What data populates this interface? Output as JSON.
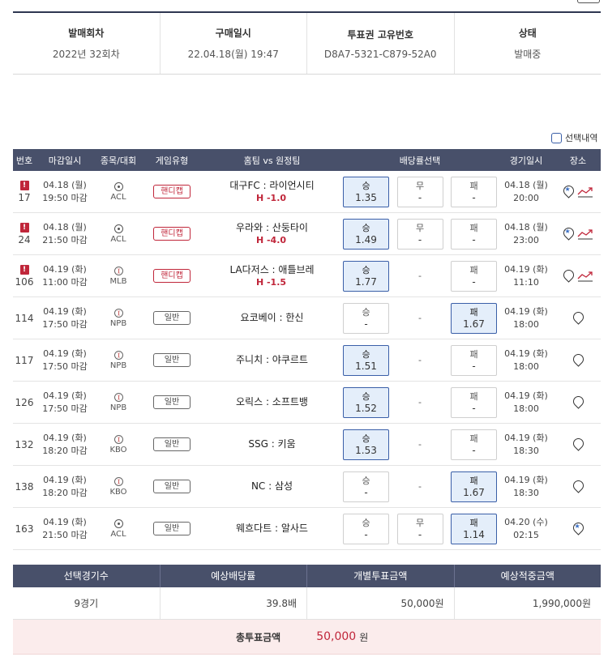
{
  "summary": [
    {
      "head": "발매회차",
      "value": "2022년 32회차"
    },
    {
      "head": "구매일시",
      "value": "22.04.18(월) 19:47"
    },
    {
      "head": "투표권 고유번호",
      "value": "D8A7-5321-C879-52A0"
    },
    {
      "head": "상태",
      "value": "발매중"
    }
  ],
  "selected_toggle": "선택내역",
  "headers": [
    "번호",
    "마감일시",
    "종목/대회",
    "게임유형",
    "홈팀 vs 원정팀",
    "배당률선택",
    "경기일시",
    "장소"
  ],
  "warn_mark": "!",
  "rows": [
    {
      "no": "17",
      "warn": true,
      "dd": "04.18 (월)",
      "dt": "19:50 마감",
      "sport": "soccer",
      "league": "ACL",
      "type": "핸디캡",
      "hc": true,
      "match": "대구FC : 라이언시티",
      "hcp": "H -1.0",
      "odds": [
        {
          "l": "승",
          "v": "1.35",
          "s": true
        },
        {
          "l": "무",
          "v": "-",
          "s": false
        },
        {
          "l": "패",
          "v": "-",
          "s": false
        }
      ],
      "gd": "04.18 (월)",
      "gt": "20:00",
      "place": "star-trend"
    },
    {
      "no": "24",
      "warn": true,
      "dd": "04.18 (월)",
      "dt": "21:50 마감",
      "sport": "soccer",
      "league": "ACL",
      "type": "핸디캡",
      "hc": true,
      "match": "우라와 : 산둥타이",
      "hcp": "H -4.0",
      "odds": [
        {
          "l": "승",
          "v": "1.49",
          "s": true
        },
        {
          "l": "무",
          "v": "-",
          "s": false
        },
        {
          "l": "패",
          "v": "-",
          "s": false
        }
      ],
      "gd": "04.18 (월)",
      "gt": "23:00",
      "place": "star-trend"
    },
    {
      "no": "106",
      "warn": true,
      "dd": "04.19 (화)",
      "dt": "11:00 마감",
      "sport": "baseball",
      "league": "MLB",
      "type": "핸디캡",
      "hc": true,
      "match": "LA다저스 : 애틀브레",
      "hcp": "H -1.5",
      "odds": [
        {
          "l": "승",
          "v": "1.77",
          "s": true
        },
        {
          "l": "-",
          "v": "",
          "s": false,
          "empty": true
        },
        {
          "l": "패",
          "v": "-",
          "s": false
        }
      ],
      "gd": "04.19 (화)",
      "gt": "11:10",
      "place": "pin-trend"
    },
    {
      "no": "114",
      "warn": false,
      "dd": "04.19 (화)",
      "dt": "17:50 마감",
      "sport": "baseball",
      "league": "NPB",
      "type": "일반",
      "hc": false,
      "match": "요코베이 : 한신",
      "hcp": "",
      "odds": [
        {
          "l": "승",
          "v": "-",
          "s": false
        },
        {
          "l": "-",
          "v": "",
          "s": false,
          "empty": true
        },
        {
          "l": "패",
          "v": "1.67",
          "s": true
        }
      ],
      "gd": "04.19 (화)",
      "gt": "18:00",
      "place": "pin"
    },
    {
      "no": "117",
      "warn": false,
      "dd": "04.19 (화)",
      "dt": "17:50 마감",
      "sport": "baseball",
      "league": "NPB",
      "type": "일반",
      "hc": false,
      "match": "주니치 : 야쿠르트",
      "hcp": "",
      "odds": [
        {
          "l": "승",
          "v": "1.51",
          "s": true
        },
        {
          "l": "-",
          "v": "",
          "s": false,
          "empty": true
        },
        {
          "l": "패",
          "v": "-",
          "s": false
        }
      ],
      "gd": "04.19 (화)",
      "gt": "18:00",
      "place": "pin"
    },
    {
      "no": "126",
      "warn": false,
      "dd": "04.19 (화)",
      "dt": "17:50 마감",
      "sport": "baseball",
      "league": "NPB",
      "type": "일반",
      "hc": false,
      "match": "오릭스 : 소프트뱅",
      "hcp": "",
      "odds": [
        {
          "l": "승",
          "v": "1.52",
          "s": true
        },
        {
          "l": "-",
          "v": "",
          "s": false,
          "empty": true
        },
        {
          "l": "패",
          "v": "-",
          "s": false
        }
      ],
      "gd": "04.19 (화)",
      "gt": "18:00",
      "place": "pin"
    },
    {
      "no": "132",
      "warn": false,
      "dd": "04.19 (화)",
      "dt": "18:20 마감",
      "sport": "baseball",
      "league": "KBO",
      "type": "일반",
      "hc": false,
      "match": "SSG : 키움",
      "hcp": "",
      "odds": [
        {
          "l": "승",
          "v": "1.53",
          "s": true
        },
        {
          "l": "-",
          "v": "",
          "s": false,
          "empty": true
        },
        {
          "l": "패",
          "v": "-",
          "s": false
        }
      ],
      "gd": "04.19 (화)",
      "gt": "18:30",
      "place": "pin"
    },
    {
      "no": "138",
      "warn": false,
      "dd": "04.19 (화)",
      "dt": "18:20 마감",
      "sport": "baseball",
      "league": "KBO",
      "type": "일반",
      "hc": false,
      "match": "NC : 삼성",
      "hcp": "",
      "odds": [
        {
          "l": "승",
          "v": "-",
          "s": false
        },
        {
          "l": "-",
          "v": "",
          "s": false,
          "empty": true
        },
        {
          "l": "패",
          "v": "1.67",
          "s": true
        }
      ],
      "gd": "04.19 (화)",
      "gt": "18:30",
      "place": "pin"
    },
    {
      "no": "163",
      "warn": false,
      "dd": "04.19 (화)",
      "dt": "21:50 마감",
      "sport": "soccer",
      "league": "ACL",
      "type": "일반",
      "hc": false,
      "match": "웨흐다트 : 알사드",
      "hcp": "",
      "odds": [
        {
          "l": "승",
          "v": "-",
          "s": false
        },
        {
          "l": "무",
          "v": "-",
          "s": false
        },
        {
          "l": "패",
          "v": "1.14",
          "s": true
        }
      ],
      "gd": "04.20 (수)",
      "gt": "02:15",
      "place": "star"
    }
  ],
  "totals": {
    "headers": [
      "선택경기수",
      "예상배당률",
      "개별투표금액",
      "예상적중금액"
    ],
    "values": [
      "9경기",
      "39.8배",
      "50,000원",
      "1,990,000원"
    ],
    "total_label": "총투표금액",
    "total_amount": "50,000",
    "total_unit": "원"
  },
  "colors": {
    "header_bg": "#48506a",
    "selected_bg": "#e4eefa",
    "selected_border": "#3a5fa8",
    "warn": "#c0263a",
    "total_bg": "#fbecec"
  }
}
